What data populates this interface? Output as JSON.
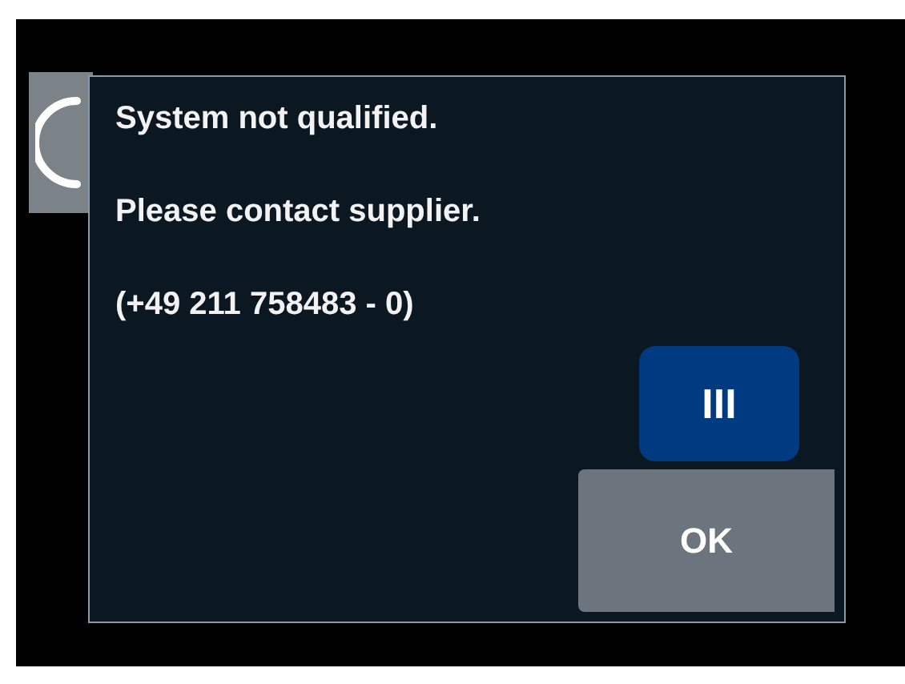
{
  "dialog": {
    "lines": [
      "System not qualified.",
      "Please contact supplier.",
      "(+49 211 758483 - 0)"
    ],
    "buttons": [
      {
        "label": "III",
        "kind": "primary"
      },
      {
        "label": "OK",
        "kind": "secondary"
      }
    ]
  }
}
